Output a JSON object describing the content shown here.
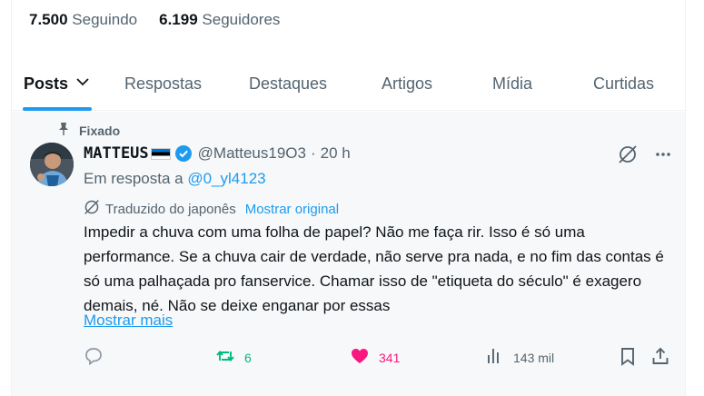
{
  "profile_stats": {
    "following_count": "7.500",
    "following_label": "Seguindo",
    "followers_count": "6.199",
    "followers_label": "Seguidores"
  },
  "tabs": [
    {
      "label": "Posts",
      "active": true
    },
    {
      "label": "Respostas"
    },
    {
      "label": "Destaques"
    },
    {
      "label": "Artigos"
    },
    {
      "label": "Mídia"
    },
    {
      "label": "Curtidas"
    }
  ],
  "post": {
    "pinned_label": "Fixado",
    "author_name": "MATTEUS",
    "author_handle": "@Matteus19O3",
    "separator": "·",
    "time": "20 h",
    "reply_prefix": "Em resposta a",
    "reply_to": "@0_yl4123",
    "translated_label": "Traduzido do japonês",
    "show_original": "Mostrar original",
    "text": "Impedir a chuva com uma folha de papel? Não me faça rir. Isso é só uma performance. Se a chuva cair de verdade, não serve pra nada, e no fim das contas é só uma palhaçada pro fanservice. Chamar isso de \"etiqueta do século\" é exagero demais, né. Não se deixe enganar por essas",
    "show_more": "Mostrar mais",
    "reposts": "6",
    "likes": "341",
    "views": "143 mil"
  },
  "colors": {
    "accent": "#1d9bf0",
    "repost_green": "#00ba7c",
    "like_pink": "#f91880",
    "muted": "#536471"
  },
  "icons": [
    "pin-icon",
    "verified-badge-icon",
    "grok-icon",
    "more-icon",
    "translate-icon",
    "reply-icon",
    "repost-icon",
    "like-icon",
    "views-icon",
    "bookmark-icon",
    "share-icon",
    "chevron-down-icon"
  ]
}
